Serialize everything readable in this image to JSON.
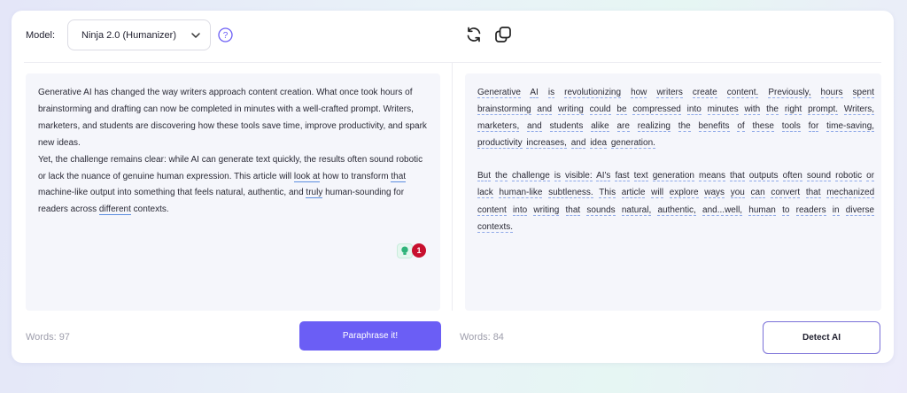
{
  "toolbar": {
    "model_label": "Model:",
    "model_value": "Ninja 2.0 (Humanizer)",
    "help_icon": "question-circle-icon",
    "refresh_icon": "refresh-icon",
    "copy_icon": "copy-icon"
  },
  "input_pane": {
    "paragraph_1": {
      "part_1": "Generative AI has changed the way writers approach content creation. What once took hours of brainstorming and drafting can now be completed in minutes with a well-crafted prompt. Writers, marketers, and students are discovering how these tools save time, improve productivity, and spark new ideas."
    },
    "paragraph_2": {
      "part_1": "Yet, the challenge remains clear: while AI can generate text quickly, the results often sound robotic or lack the nuance of genuine human expression. This article will ",
      "suggest_1": "look at",
      "part_2": " how to transform ",
      "suggest_2": "that",
      "part_3": " machine-like output into something that feels natural, authentic, and ",
      "suggest_3": "truly",
      "part_4": " human-sounding for readers across ",
      "suggest_4": "different",
      "part_5": " contexts."
    },
    "suggestion_count": "1",
    "word_count": "Words: 97"
  },
  "output_pane": {
    "paragraph_1": [
      "Generative",
      "AI",
      "is",
      "revolutionizing",
      "how",
      "writers",
      "create",
      "content.",
      "Previously,",
      "hours",
      "spent",
      "brainstorming",
      "and",
      "writing",
      "could",
      "be",
      "compressed",
      "into",
      "minutes",
      "with",
      "the",
      "right",
      "prompt.",
      "Writers,",
      "marketers,",
      "and",
      "students",
      "alike",
      "are",
      "realizing",
      "the",
      "benefits",
      "of",
      "these",
      "tools",
      "for",
      "time-saving,",
      "productivity",
      "increases,",
      "and",
      "idea",
      "generation."
    ],
    "paragraph_2": [
      "But",
      "the",
      "challenge",
      "is",
      "visible:",
      "AI's",
      "fast",
      "text",
      "generation",
      "means",
      "that",
      "outputs",
      "often",
      "sound",
      "robotic",
      "or",
      "lack",
      "human-like",
      "subtleness.",
      "This",
      "article",
      "will",
      "explore",
      "ways",
      "you",
      "can",
      "convert",
      "that",
      "mechanized",
      "content",
      "into",
      "writing",
      "that",
      "sounds",
      "natural,",
      "authentic,",
      "and...well,",
      "human",
      "to",
      "readers",
      "in",
      "diverse",
      "contexts."
    ],
    "word_count": "Words: 84"
  },
  "actions": {
    "paraphrase_label": "Paraphrase it!",
    "detect_label": "Detect AI"
  },
  "colors": {
    "accent": "#6b5ef5",
    "badge_red": "#c8102e",
    "underline_blue": "#5c8ee0"
  }
}
